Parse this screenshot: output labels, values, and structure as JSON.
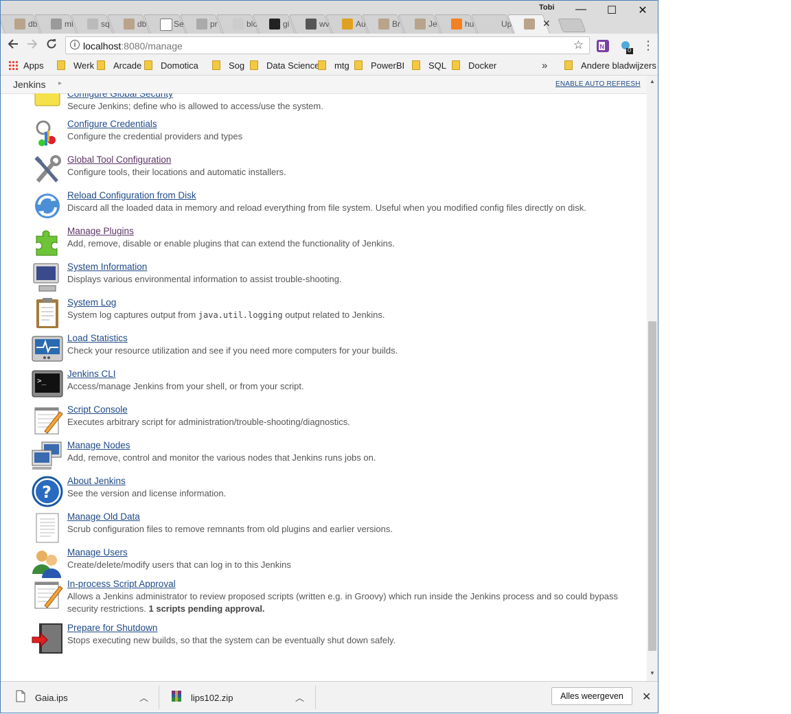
{
  "browser": {
    "profile_name": "Tobi",
    "tabs": [
      {
        "label": "db",
        "icon": "jenkins-icon"
      },
      {
        "label": "mi",
        "icon": "page-icon"
      },
      {
        "label": "sq",
        "icon": "settings-icon"
      },
      {
        "label": "db",
        "icon": "jenkins-icon"
      },
      {
        "label": "Se",
        "icon": "document-icon"
      },
      {
        "label": "pr",
        "icon": "image-icon"
      },
      {
        "label": "blo",
        "icon": "at-icon"
      },
      {
        "label": "gi",
        "icon": "github-icon"
      },
      {
        "label": "wv",
        "icon": "linkedin-icon"
      },
      {
        "label": "Au",
        "icon": "database-icon"
      },
      {
        "label": "Br",
        "icon": "jenkins-icon"
      },
      {
        "label": "Je",
        "icon": "jenkins-icon"
      },
      {
        "label": "hu",
        "icon": "stackoverflow-icon"
      },
      {
        "label": "Up",
        "icon": "blank-icon"
      },
      {
        "label": "",
        "icon": "jenkins-icon",
        "active": true
      }
    ],
    "window_controls": {
      "minimize": "—",
      "maximize": "☐",
      "close": "✕"
    },
    "address": {
      "host": "localhost",
      "port_path": ":8080/manage"
    },
    "extensions": [
      {
        "name": "onenote-icon"
      },
      {
        "name": "badge-extension-icon",
        "count": "0"
      }
    ],
    "bookmarks": {
      "apps": "Apps",
      "folders": [
        "Werk",
        "Arcade",
        "Domotica",
        "Sog",
        "Data Science",
        "mtg",
        "PowerBI",
        "SQL",
        "Docker"
      ],
      "overflow": "»",
      "other": "Andere bladwijzers"
    }
  },
  "jenkins": {
    "breadcrumb": "Jenkins",
    "auto_refresh": "ENABLE AUTO REFRESH",
    "items": [
      {
        "title": "Configure Global Security",
        "desc": "Secure Jenkins; define who is allowed to access/use the system.",
        "icon": "lock-icon"
      },
      {
        "title": "Configure Credentials",
        "desc": "Configure the credential providers and types",
        "icon": "keys-icon"
      },
      {
        "title": "Global Tool Configuration",
        "desc": "Configure tools, their locations and automatic installers.",
        "icon": "tools-icon",
        "visited": true
      },
      {
        "title": "Reload Configuration from Disk",
        "desc": "Discard all the loaded data in memory and reload everything from file system. Useful when you modified config files directly on disk.",
        "icon": "reload-icon"
      },
      {
        "title": "Manage Plugins",
        "desc": "Add, remove, disable or enable plugins that can extend the functionality of Jenkins.",
        "icon": "puzzle-icon",
        "visited": true
      },
      {
        "title": "System Information",
        "desc": "Displays various environmental information to assist trouble-shooting.",
        "icon": "computer-icon"
      },
      {
        "title": "System Log",
        "desc_pre": "System log captures output from ",
        "desc_code": "java.util.logging",
        "desc_post": " output related to Jenkins.",
        "icon": "clipboard-icon"
      },
      {
        "title": "Load Statistics",
        "desc": "Check your resource utilization and see if you need more computers for your builds.",
        "icon": "monitor-graph-icon"
      },
      {
        "title": "Jenkins CLI",
        "desc": "Access/manage Jenkins from your shell, or from your script.",
        "icon": "terminal-icon"
      },
      {
        "title": "Script Console",
        "desc": "Executes arbitrary script for administration/trouble-shooting/diagnostics.",
        "icon": "notepad-icon"
      },
      {
        "title": "Manage Nodes",
        "desc": "Add, remove, control and monitor the various nodes that Jenkins runs jobs on.",
        "icon": "network-computers-icon"
      },
      {
        "title": "About Jenkins",
        "desc": "See the version and license information.",
        "icon": "help-icon"
      },
      {
        "title": "Manage Old Data",
        "desc": "Scrub configuration files to remove remnants from old plugins and earlier versions.",
        "icon": "document-icon"
      },
      {
        "title": "Manage Users",
        "desc": "Create/delete/modify users that can log in to this Jenkins",
        "icon": "users-icon"
      },
      {
        "title": "In-process Script Approval",
        "desc": "Allows a Jenkins administrator to review proposed scripts (written e.g. in Groovy) which run inside the Jenkins process and so could bypass security restrictions.",
        "desc_bold": "1 scripts pending approval.",
        "icon": "notepad-icon"
      },
      {
        "title": "Prepare for Shutdown",
        "desc": "Stops executing new builds, so that the system can be eventually shut down safely.",
        "icon": "shutdown-icon"
      }
    ]
  },
  "downloads": {
    "files": [
      {
        "name": "Gaia.ips",
        "icon": "file-icon"
      },
      {
        "name": "lips102.zip",
        "icon": "archive-icon"
      }
    ],
    "show_all": "Alles weergeven"
  }
}
